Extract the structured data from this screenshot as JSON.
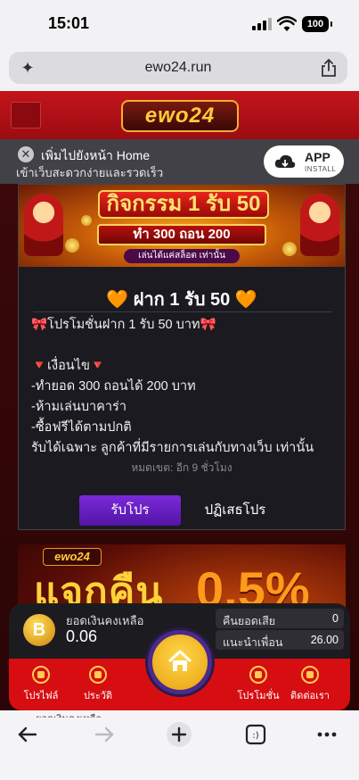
{
  "status_bar": {
    "time": "15:01",
    "battery": "100"
  },
  "browser": {
    "url": "ewo24.run"
  },
  "site": {
    "logo": "ewo24"
  },
  "install_banner": {
    "title": "เพิ่มไปยังหน้า Home",
    "subtitle": "เข้าเว็บสะดวกง่ายและรวดเร็ว",
    "app_label": "APP",
    "app_sub": "INSTALL"
  },
  "promo": {
    "banner_line1": "กิจกรรม 1 รับ 50",
    "banner_line2": "ทำ 300 ถอน 200",
    "banner_line3": "เล่นได้แค่สล็อต เท่านั้น",
    "title": "🧡 ฝาก 1 รับ 50 🧡",
    "lines": [
      "🎀โปรโมชั่นฝาก 1 รับ 50 บาท🎀",
      "",
      "🔻เงื่อนไข🔻",
      "-ทำยอด 300 ถอนได้ 200 บาท",
      "-ห้ามเล่นบาคาร่า",
      "-ซื้อฟรีได้ตามปกติ",
      "รับได้เฉพาะ ลูกค้าที่มีรายการเล่นกับทางเว็บ เท่านั้น"
    ],
    "expiry": "หมดเขต: อีก 9 ชั่วโมง",
    "accept": "รับโปร",
    "decline": "ปฏิเสธโปร"
  },
  "cashback_banner": {
    "logo": "ewo24",
    "text": "แจกคืน",
    "percent": "0.5%"
  },
  "wallet": {
    "balance_label": "ยอดเงินคงเหลือ",
    "balance": "0.06",
    "coin_symbol": "B",
    "stats": [
      {
        "label": "คืนยอดเสีย",
        "value": "0"
      },
      {
        "label": "แนะนำเพื่อน",
        "value": "26.00"
      }
    ]
  },
  "bottom_nav": {
    "items": [
      {
        "label": "โปรไฟล์"
      },
      {
        "label": "ประวัติ"
      },
      {
        "label": "โปรโมชั่น"
      },
      {
        "label": "ติดต่อเรา"
      }
    ]
  },
  "peek_text": "ยอดเงินคงเหลือ",
  "colors": {
    "accent_red": "#d60e12",
    "button_purple": "#6a1ec4",
    "gold": "#ffcb3a"
  }
}
